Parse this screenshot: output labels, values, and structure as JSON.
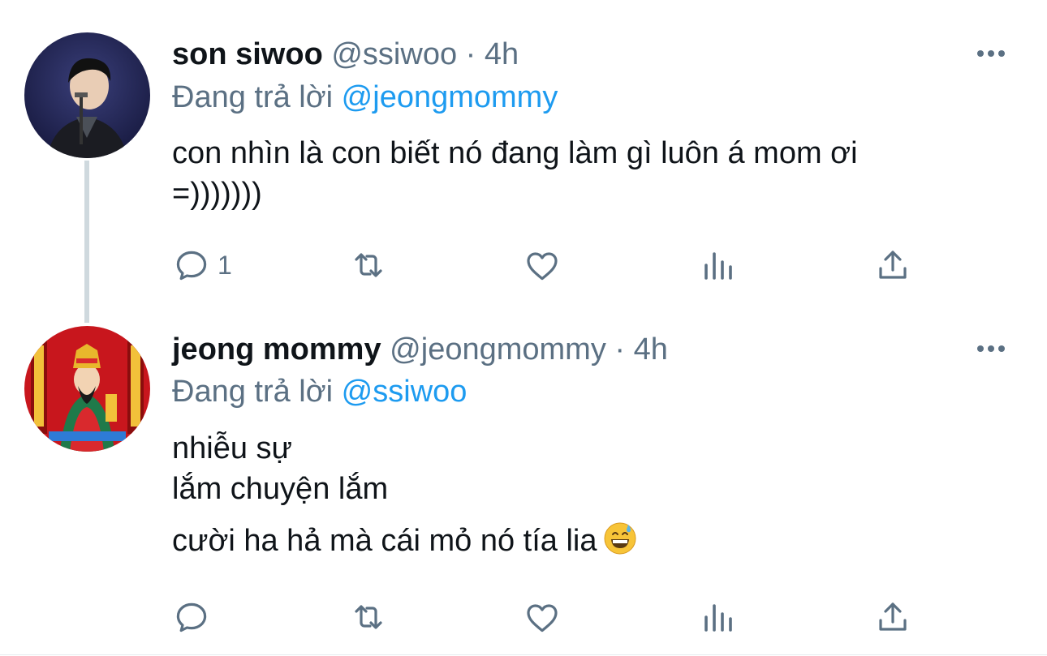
{
  "tweets": [
    {
      "name": "son siwoo",
      "handle": "@ssiwoo",
      "sep": "·",
      "time": "4h",
      "reply_prefix": "Đang trả lời",
      "reply_to": "@jeongmommy",
      "lines": [
        "con nhìn là con biết nó đang làm gì luôn á mom ơi",
        "=)))))))"
      ],
      "reply_count": "1",
      "avatar_icon": "person-photo-avatar"
    },
    {
      "name": "jeong mommy",
      "handle": "@jeongmommy",
      "sep": "·",
      "time": "4h",
      "reply_prefix": "Đang trả lời",
      "reply_to": "@ssiwoo",
      "lines": [
        "nhiễu sự",
        "lắm chuyện lắm",
        "cười ha hả mà cái mỏ nó tía lia"
      ],
      "reply_count": "",
      "avatar_icon": "deity-painting-avatar",
      "emoji": "grinning-sweat-emoji"
    }
  ],
  "colors": {
    "accent": "#1d9bf0",
    "secondary": "#5b7083",
    "text": "#0f1419",
    "thread": "#cfd9de"
  }
}
